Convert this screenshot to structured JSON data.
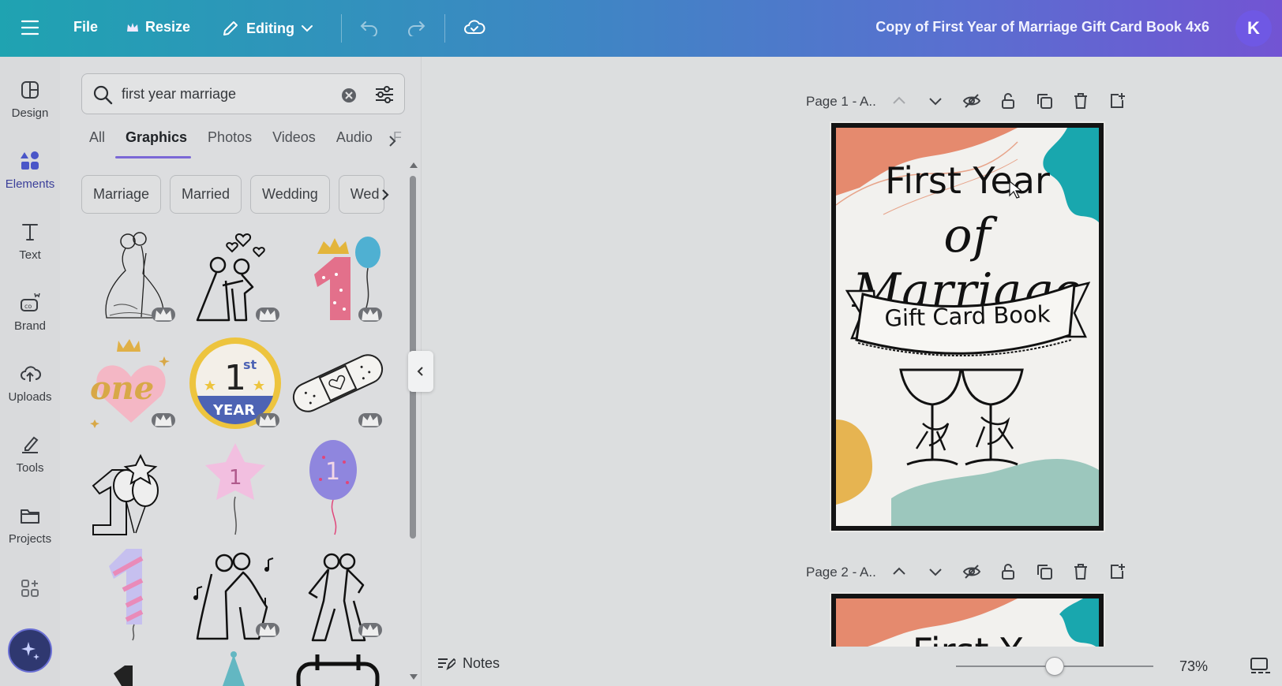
{
  "topbar": {
    "file": "File",
    "resize": "Resize",
    "editing": "Editing",
    "doc_title": "Copy of First Year of Marriage Gift Card Book 4x6",
    "avatar_letter": "K"
  },
  "rail": {
    "items": [
      {
        "label": "Design",
        "icon": "layout-icon"
      },
      {
        "label": "Elements",
        "icon": "shapes-icon"
      },
      {
        "label": "Text",
        "icon": "text-icon"
      },
      {
        "label": "Brand",
        "icon": "brand-icon"
      },
      {
        "label": "Uploads",
        "icon": "cloud-upload-icon"
      },
      {
        "label": "Tools",
        "icon": "pen-icon"
      },
      {
        "label": "Projects",
        "icon": "folder-icon"
      }
    ]
  },
  "search": {
    "query": "first year marriage"
  },
  "tabs": [
    "All",
    "Graphics",
    "Photos",
    "Videos",
    "Audio",
    "F"
  ],
  "chips": [
    "Marriage",
    "Married",
    "Wedding",
    "Wed"
  ],
  "pages": [
    {
      "label": "Page 1 - A..",
      "title_line1": "First Year",
      "title_line2": "of Marriage",
      "banner": "Gift Card Book"
    },
    {
      "label": "Page 2 - A..",
      "title_line1": "First Y"
    }
  ],
  "bottom": {
    "notes": "Notes",
    "zoom": "73%"
  },
  "colors": {
    "accent": "#7b68d6",
    "coral": "#e58a6e",
    "teal": "#19a7ae",
    "mustard": "#e6b451",
    "sage": "#9cc7bd"
  }
}
